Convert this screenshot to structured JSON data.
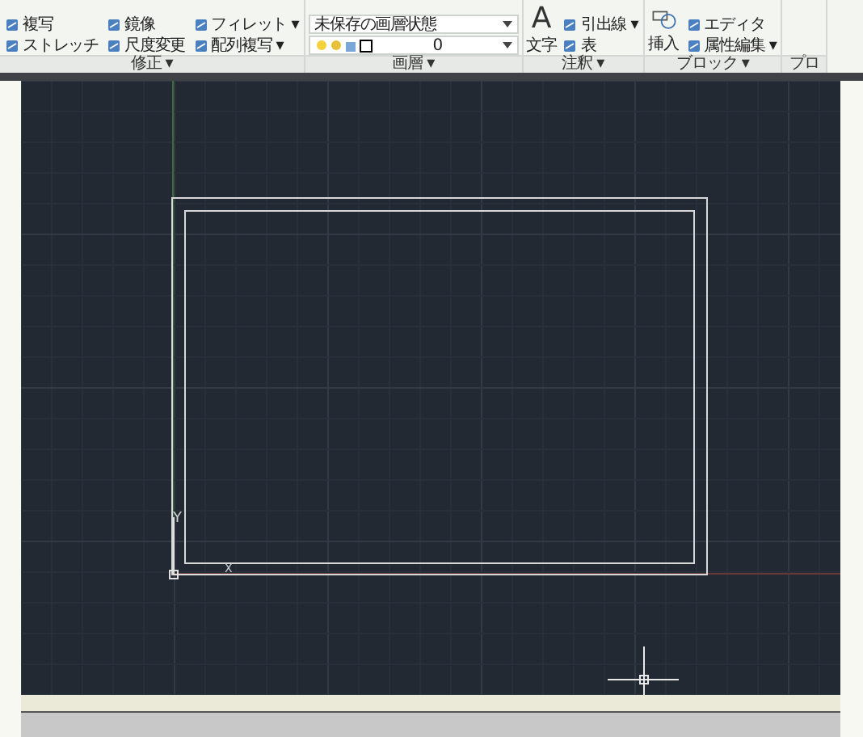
{
  "ribbon": {
    "panels": [
      {
        "title": "修正 ▾",
        "columns": [
          [
            {
              "kind": "tool",
              "label": "複写"
            },
            {
              "kind": "tool",
              "label": "ストレッチ"
            }
          ],
          [
            {
              "kind": "tool",
              "label": "鏡像"
            },
            {
              "kind": "tool",
              "label": "尺度変更"
            }
          ],
          [
            {
              "kind": "tool",
              "label": "フィレット ▾"
            },
            {
              "kind": "tool",
              "label": "配列複写 ▾"
            }
          ]
        ]
      },
      {
        "title": "画層 ▾",
        "columns": [
          [
            {
              "kind": "select",
              "label": "未保存の画層状態"
            },
            {
              "kind": "layer",
              "label": "0"
            }
          ]
        ]
      },
      {
        "title": "注釈 ▾",
        "columns": [
          [
            {
              "kind": "large",
              "glyph": "A",
              "label": "文字"
            }
          ],
          [
            {
              "kind": "tool",
              "label": "引出線 ▾"
            },
            {
              "kind": "tool",
              "label": "表"
            }
          ]
        ]
      },
      {
        "title": "ブロック ▾",
        "columns": [
          [
            {
              "kind": "large",
              "label": "挿入"
            }
          ],
          [
            {
              "kind": "tool",
              "label": "エディタ"
            },
            {
              "kind": "tool",
              "label": "属性編集 ▾"
            }
          ]
        ]
      },
      {
        "title": "プロ"
      }
    ]
  },
  "ucs": {
    "x_label": "X",
    "y_label": "Y"
  }
}
